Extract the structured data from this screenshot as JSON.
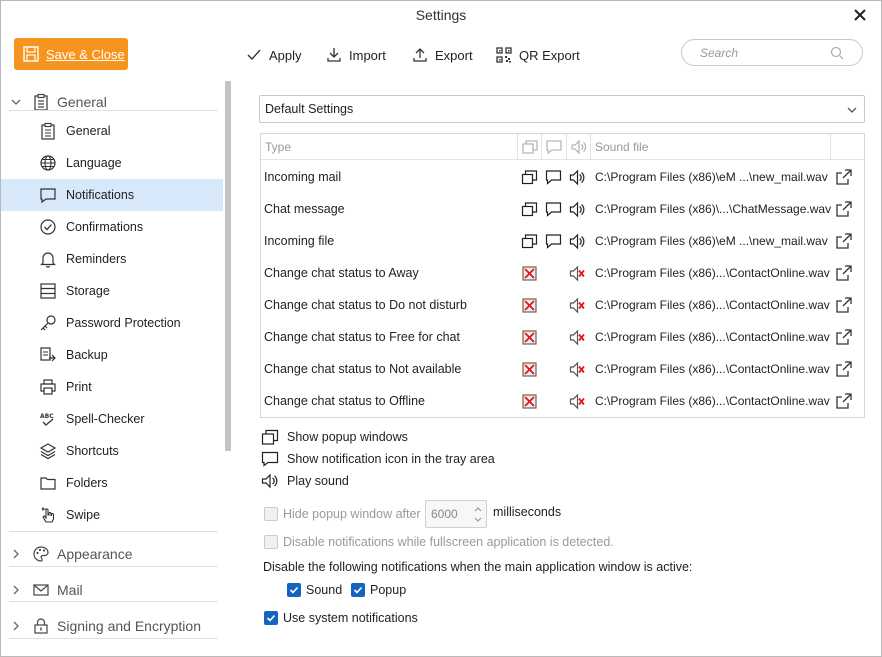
{
  "window": {
    "title": "Settings"
  },
  "toolbar": {
    "save_close": "Save & Close",
    "apply": "Apply",
    "import": "Import",
    "export": "Export",
    "qr_export": "QR Export",
    "search_placeholder": "Search"
  },
  "sidebar": {
    "groups": {
      "general": "General",
      "appearance": "Appearance",
      "mail": "Mail",
      "signing": "Signing and Encryption"
    },
    "items": [
      {
        "label": "General",
        "icon": "clipboard-icon"
      },
      {
        "label": "Language",
        "icon": "globe-icon"
      },
      {
        "label": "Notifications",
        "icon": "chat-bubble-icon"
      },
      {
        "label": "Confirmations",
        "icon": "check-circle-icon"
      },
      {
        "label": "Reminders",
        "icon": "bell-icon"
      },
      {
        "label": "Storage",
        "icon": "storage-icon"
      },
      {
        "label": "Password Protection",
        "icon": "key-icon"
      },
      {
        "label": "Backup",
        "icon": "backup-icon"
      },
      {
        "label": "Print",
        "icon": "printer-icon"
      },
      {
        "label": "Spell-Checker",
        "icon": "spell-check-icon"
      },
      {
        "label": "Shortcuts",
        "icon": "layers-icon"
      },
      {
        "label": "Folders",
        "icon": "folder-icon"
      },
      {
        "label": "Swipe",
        "icon": "hand-swipe-icon"
      }
    ],
    "selected": "Notifications"
  },
  "content": {
    "preset": "Default Settings",
    "table": {
      "headers": {
        "type": "Type",
        "sound_file": "Sound file"
      },
      "rows": [
        {
          "type": "Incoming mail",
          "popup": true,
          "tray": true,
          "sound": true,
          "file": "C:\\Program Files (x86)\\eM ...\\new_mail.wav"
        },
        {
          "type": "Chat message",
          "popup": true,
          "tray": true,
          "sound": true,
          "file": "C:\\Program Files (x86)\\...\\ChatMessage.wav"
        },
        {
          "type": "Incoming file",
          "popup": true,
          "tray": true,
          "sound": true,
          "file": "C:\\Program Files (x86)\\eM ...\\new_mail.wav"
        },
        {
          "type": "Change chat status to Away",
          "popup": false,
          "tray": false,
          "sound": false,
          "file": "C:\\Program Files (x86)...\\ContactOnline.wav"
        },
        {
          "type": "Change chat status to Do not disturb",
          "popup": false,
          "tray": false,
          "sound": false,
          "file": "C:\\Program Files (x86)...\\ContactOnline.wav"
        },
        {
          "type": "Change chat status to Free for chat",
          "popup": false,
          "tray": false,
          "sound": false,
          "file": "C:\\Program Files (x86)...\\ContactOnline.wav"
        },
        {
          "type": "Change chat status to Not available",
          "popup": false,
          "tray": false,
          "sound": false,
          "file": "C:\\Program Files (x86)...\\ContactOnline.wav"
        },
        {
          "type": "Change chat status to Offline",
          "popup": false,
          "tray": false,
          "sound": false,
          "file": "C:\\Program Files (x86)...\\ContactOnline.wav"
        }
      ]
    },
    "legend": {
      "popup": "Show popup windows",
      "tray": "Show notification icon in the tray area",
      "sound": "Play sound"
    },
    "hide_popup": {
      "label": "Hide popup window after",
      "value": "6000",
      "unit": "milliseconds",
      "checked": false
    },
    "fullscreen": {
      "label": "Disable notifications while fullscreen application is detected.",
      "checked": false
    },
    "disable_label": "Disable the following notifications when the main application window is active:",
    "disable_sound": {
      "label": "Sound",
      "checked": true
    },
    "disable_popup": {
      "label": "Popup",
      "checked": true
    },
    "system_notifications": {
      "label": "Use system notifications",
      "checked": true
    }
  }
}
